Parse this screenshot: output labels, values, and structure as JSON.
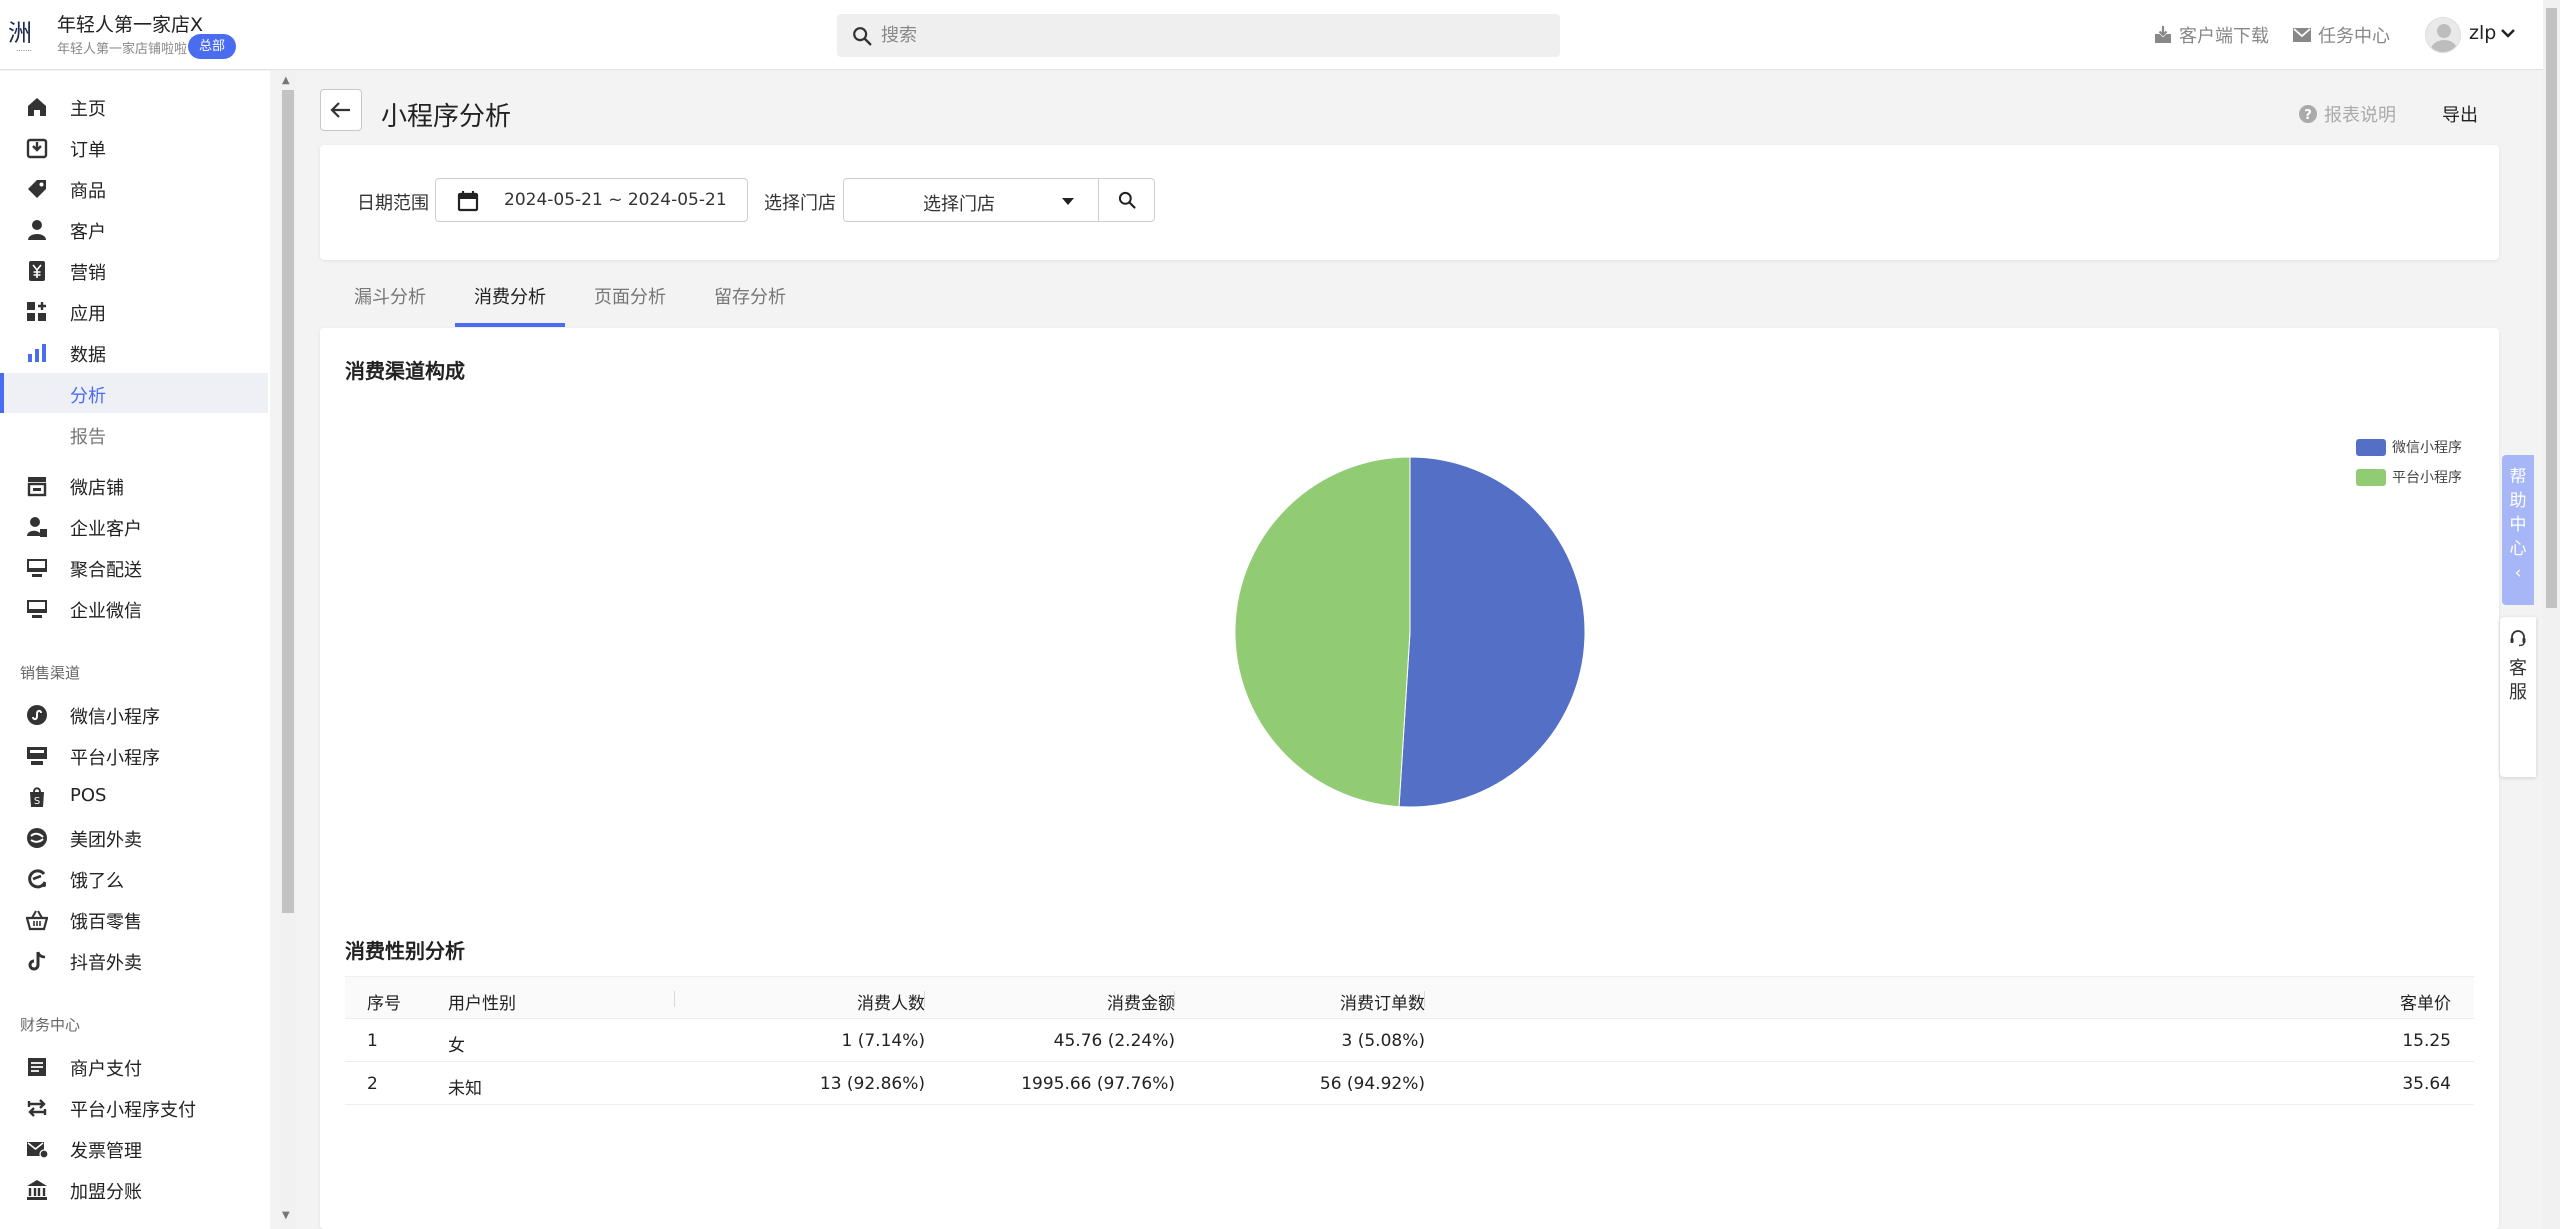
{
  "topbar": {
    "logo_text": "洲",
    "shop_name": "年轻人第一家店X",
    "shop_sub": "年轻人第一家店铺啦啦",
    "hq_badge": "总部",
    "search_placeholder": "搜索",
    "client_download": "客户端下载",
    "task_center": "任务中心",
    "user_name": "zlp"
  },
  "sidebar": {
    "items": [
      {
        "label": "主页",
        "icon": "home-icon"
      },
      {
        "label": "订单",
        "icon": "order-icon"
      },
      {
        "label": "商品",
        "icon": "tag-icon"
      },
      {
        "label": "客户",
        "icon": "person-icon"
      },
      {
        "label": "营销",
        "icon": "yen-icon"
      },
      {
        "label": "应用",
        "icon": "apps-icon"
      },
      {
        "label": "数据",
        "icon": "bar-chart-icon"
      },
      {
        "label": "分析",
        "sub": true,
        "active": true
      },
      {
        "label": "报告",
        "sub": true
      },
      {
        "label": "微店铺",
        "icon": "store-icon"
      },
      {
        "label": "企业客户",
        "icon": "enterprise-user-icon"
      },
      {
        "label": "聚合配送",
        "icon": "monitor-icon"
      },
      {
        "label": "企业微信",
        "icon": "monitor-icon"
      }
    ],
    "section_sales": "销售渠道",
    "sales_items": [
      {
        "label": "微信小程序",
        "icon": "mini-program-icon"
      },
      {
        "label": "平台小程序",
        "icon": "platform-icon"
      },
      {
        "label": "POS",
        "icon": "shopify-bag-icon"
      },
      {
        "label": "美团外卖",
        "icon": "meituan-icon"
      },
      {
        "label": "饿了么",
        "icon": "eleme-icon"
      },
      {
        "label": "饿百零售",
        "icon": "basket-icon"
      },
      {
        "label": "抖音外卖",
        "icon": "tiktok-icon"
      }
    ],
    "section_finance": "财务中心",
    "finance_items": [
      {
        "label": "商户支付",
        "icon": "document-icon"
      },
      {
        "label": "平台小程序支付",
        "icon": "transfer-icon"
      },
      {
        "label": "发票管理",
        "icon": "invoice-icon"
      },
      {
        "label": "加盟分账",
        "icon": "bank-icon"
      }
    ]
  },
  "page": {
    "title": "小程序分析",
    "report_desc": "报表说明",
    "export": "导出"
  },
  "filters": {
    "date_label": "日期范围",
    "date_value": "2024-05-21 ~ 2024-05-21",
    "store_label": "选择门店",
    "store_value": "选择门店"
  },
  "tabs": [
    {
      "label": "漏斗分析"
    },
    {
      "label": "消费分析",
      "active": true
    },
    {
      "label": "页面分析"
    },
    {
      "label": "留存分析"
    }
  ],
  "pie_section_title": "消费渠道构成",
  "chart_data": {
    "type": "pie",
    "title": "",
    "categories": [
      "微信小程序",
      "平台小程序"
    ],
    "values": [
      51,
      49
    ],
    "colors": [
      "#5470c6",
      "#91cc75"
    ],
    "legend_position": "top-right"
  },
  "table_section_title": "消费性别分析",
  "table": {
    "headers": [
      "序号",
      "用户性别",
      "消费人数",
      "消费金额",
      "消费订单数",
      "客单价"
    ],
    "rows": [
      [
        "1",
        "女",
        "1 (7.14%)",
        "45.76 (2.24%)",
        "3 (5.08%)",
        "15.25"
      ],
      [
        "2",
        "未知",
        "13 (92.86%)",
        "1995.66 (97.76%)",
        "56 (94.92%)",
        "35.64"
      ]
    ]
  },
  "floating": {
    "help_center": "帮助中心",
    "help_arrow": "‹",
    "customer_service": "客服"
  }
}
